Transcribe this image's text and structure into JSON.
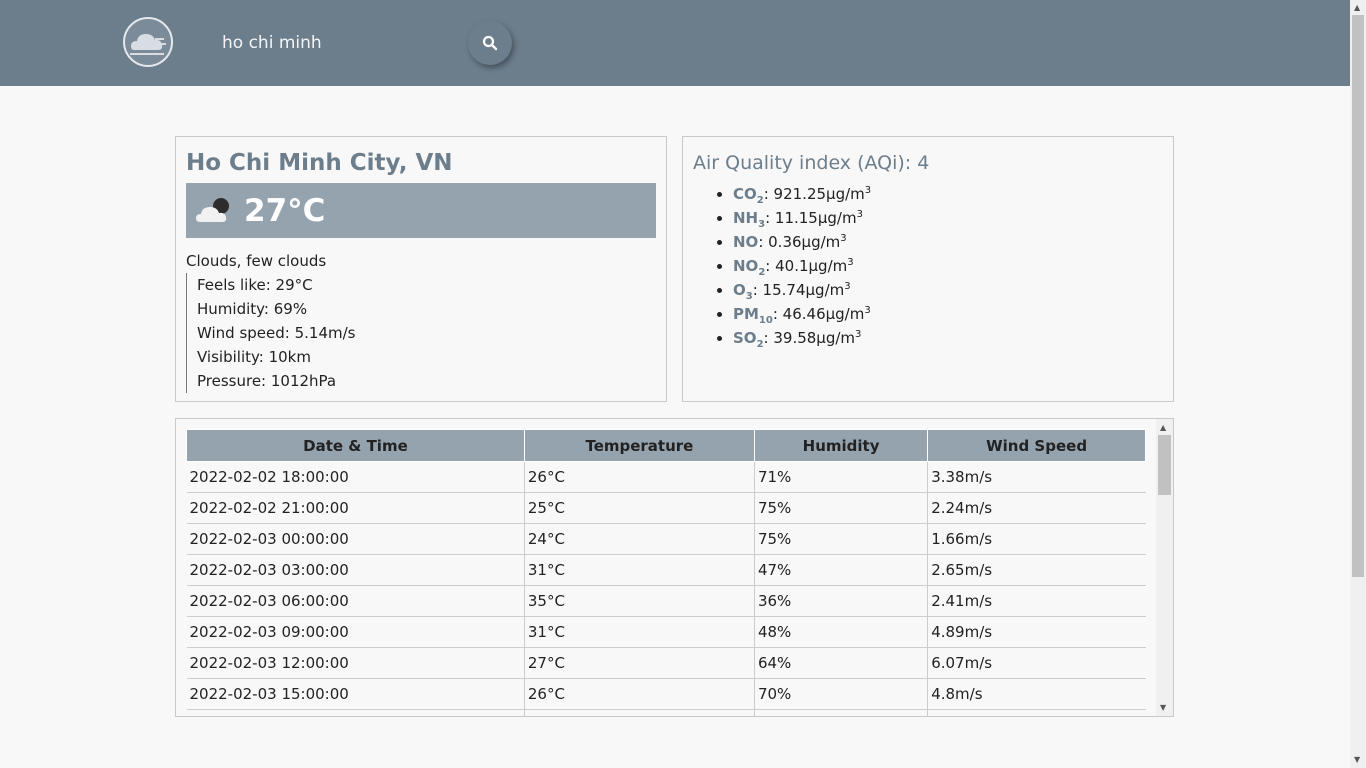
{
  "header": {
    "logo": "cloud-wind-logo",
    "search_value": "ho chi minh",
    "search_icon": "search-icon",
    "bar_color": "#6c7d8c"
  },
  "current": {
    "city": "Ho Chi Minh City, VN",
    "temperature": "27°C",
    "icon": "cloud-night-icon",
    "description": "Clouds, few clouds",
    "details": [
      "Feels like: 29°C",
      "Humidity: 69%",
      "Wind speed: 5.14m/s",
      "Visibility: 10km",
      "Pressure: 1012hPa"
    ]
  },
  "air_quality": {
    "title": "Air Quality index (AQi): 4",
    "items": [
      {
        "name": "CO",
        "sub": "2",
        "value": ": 921.25µg/m",
        "sup": "3"
      },
      {
        "name": "NH",
        "sub": "3",
        "value": ": 11.15µg/m",
        "sup": "3"
      },
      {
        "name": "NO",
        "sub": "",
        "value": ": 0.36µg/m",
        "sup": "3"
      },
      {
        "name": "NO",
        "sub": "2",
        "value": ": 40.1µg/m",
        "sup": "3"
      },
      {
        "name": "O",
        "sub": "3",
        "value": ": 15.74µg/m",
        "sup": "3"
      },
      {
        "name": "PM",
        "sub": "10",
        "value": ": 46.46µg/m",
        "sup": "3"
      },
      {
        "name": "SO",
        "sub": "2",
        "value": ": 39.58µg/m",
        "sup": "3"
      }
    ]
  },
  "forecast": {
    "columns": [
      "Date & Time",
      "Temperature",
      "Humidity",
      "Wind Speed"
    ],
    "rows": [
      [
        "2022-02-02 18:00:00",
        "26°C",
        "71%",
        "3.38m/s"
      ],
      [
        "2022-02-02 21:00:00",
        "25°C",
        "75%",
        "2.24m/s"
      ],
      [
        "2022-02-03 00:00:00",
        "24°C",
        "75%",
        "1.66m/s"
      ],
      [
        "2022-02-03 03:00:00",
        "31°C",
        "47%",
        "2.65m/s"
      ],
      [
        "2022-02-03 06:00:00",
        "35°C",
        "36%",
        "2.41m/s"
      ],
      [
        "2022-02-03 09:00:00",
        "31°C",
        "48%",
        "4.89m/s"
      ],
      [
        "2022-02-03 12:00:00",
        "27°C",
        "64%",
        "6.07m/s"
      ],
      [
        "2022-02-03 15:00:00",
        "26°C",
        "70%",
        "4.8m/s"
      ],
      [
        "",
        "",
        "",
        ""
      ]
    ]
  }
}
